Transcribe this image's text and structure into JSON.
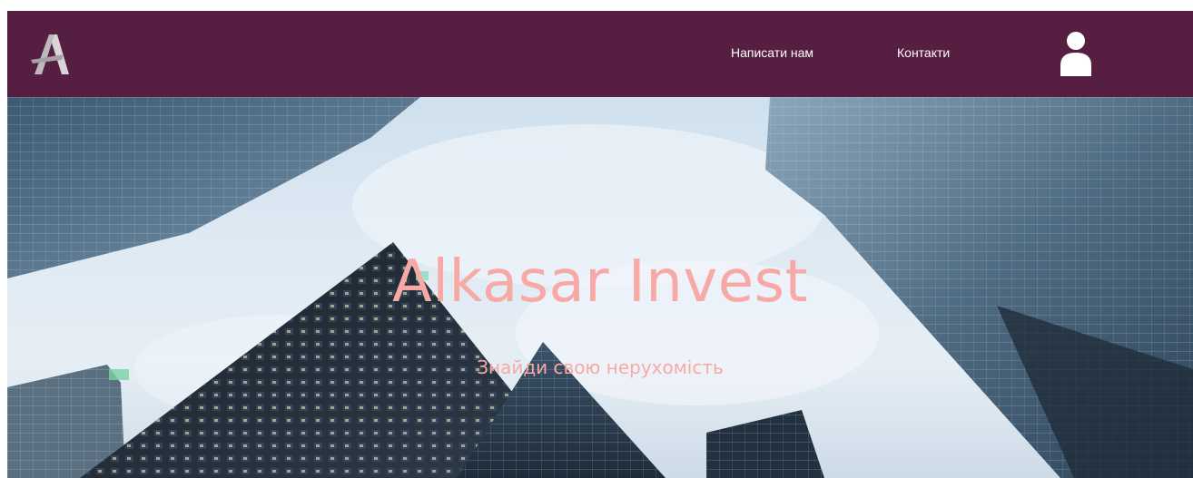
{
  "header": {
    "logo_icon": "alkasar-logo-icon",
    "nav": {
      "write_us": "Написати нам",
      "contacts": "Контакти"
    },
    "profile_icon": "user-icon",
    "background_color": "#561f42"
  },
  "hero": {
    "title": "Alkasar Invest",
    "subtitle": "Знайди свою нерухомість",
    "text_color": "#f7a9a6",
    "background_image": "skyscrapers-looking-up"
  }
}
